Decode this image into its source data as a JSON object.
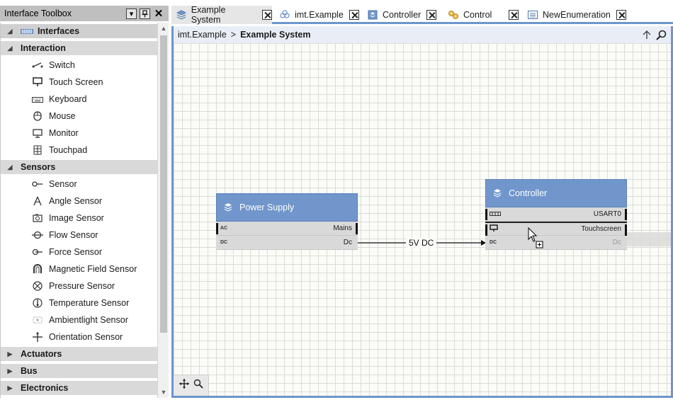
{
  "toolbox": {
    "title": "Interface Toolbox",
    "header_icons": [
      "dropdown-icon",
      "pin-icon",
      "close-icon"
    ],
    "root": {
      "label": "Interfaces",
      "icon": "interfaces-icon"
    },
    "categories": [
      {
        "label": "Interaction",
        "expanded": true,
        "items": [
          {
            "label": "Switch",
            "icon": "switch-icon"
          },
          {
            "label": "Touch Screen",
            "icon": "touch-screen-icon"
          },
          {
            "label": "Keyboard",
            "icon": "keyboard-icon"
          },
          {
            "label": "Mouse",
            "icon": "mouse-icon"
          },
          {
            "label": "Monitor",
            "icon": "monitor-icon"
          },
          {
            "label": "Touchpad",
            "icon": "touchpad-icon"
          }
        ]
      },
      {
        "label": "Sensors",
        "expanded": true,
        "items": [
          {
            "label": "Sensor",
            "icon": "sensor-icon"
          },
          {
            "label": "Angle Sensor",
            "icon": "angle-sensor-icon"
          },
          {
            "label": "Image Sensor",
            "icon": "image-sensor-icon"
          },
          {
            "label": "Flow Sensor",
            "icon": "flow-sensor-icon"
          },
          {
            "label": "Force Sensor",
            "icon": "force-sensor-icon"
          },
          {
            "label": "Magnetic Field Sensor",
            "icon": "magnetic-field-sensor-icon"
          },
          {
            "label": "Pressure Sensor",
            "icon": "pressure-sensor-icon"
          },
          {
            "label": "Temperature Sensor",
            "icon": "temperature-sensor-icon"
          },
          {
            "label": "Ambientlight Sensor",
            "icon": "ambientlight-sensor-icon"
          },
          {
            "label": "Orientation Sensor",
            "icon": "orientation-sensor-icon"
          }
        ]
      },
      {
        "label": "Actuators",
        "expanded": false,
        "items": []
      },
      {
        "label": "Bus",
        "expanded": false,
        "items": []
      },
      {
        "label": "Electronics",
        "expanded": false,
        "items": []
      }
    ]
  },
  "tabs": [
    {
      "label": "Example System",
      "icon": "system-icon",
      "active": true
    },
    {
      "label": "imt.Example",
      "icon": "package-icon",
      "active": false
    },
    {
      "label": "Controller",
      "icon": "component-icon",
      "active": false
    },
    {
      "label": "Control",
      "icon": "control-icon",
      "active": false
    },
    {
      "label": "NewEnumeration",
      "icon": "enumeration-icon",
      "active": false
    }
  ],
  "breadcrumb": {
    "parent": "imt.Example",
    "separator": ">",
    "current": "Example System",
    "actions": [
      "navigate-up-icon",
      "search-icon"
    ]
  },
  "diagram": {
    "blocks": [
      {
        "name": "Power Supply",
        "ports": [
          {
            "label": "Mains",
            "type_icon": "AC"
          },
          {
            "label": "Dc",
            "type_icon": "DC"
          }
        ]
      },
      {
        "name": "Controller",
        "ports": [
          {
            "label": "USART0",
            "type_icon": "serial"
          },
          {
            "label": "Touchscreen",
            "type_icon": "touch-screen"
          },
          {
            "label": "Dc",
            "type_icon": "DC"
          }
        ]
      }
    ],
    "connection": {
      "label": "5V DC",
      "from": "Power Supply.Dc",
      "to": "Controller.Dc"
    }
  },
  "canvas_tools": [
    "pan-icon",
    "zoom-icon"
  ],
  "colors": {
    "accent": "#6d96cd",
    "block_header": "#7096cc",
    "port_bg": "#d9d9d9",
    "category_bg": "#d9d9d9",
    "toolbox_header": "#bfbfbf"
  }
}
